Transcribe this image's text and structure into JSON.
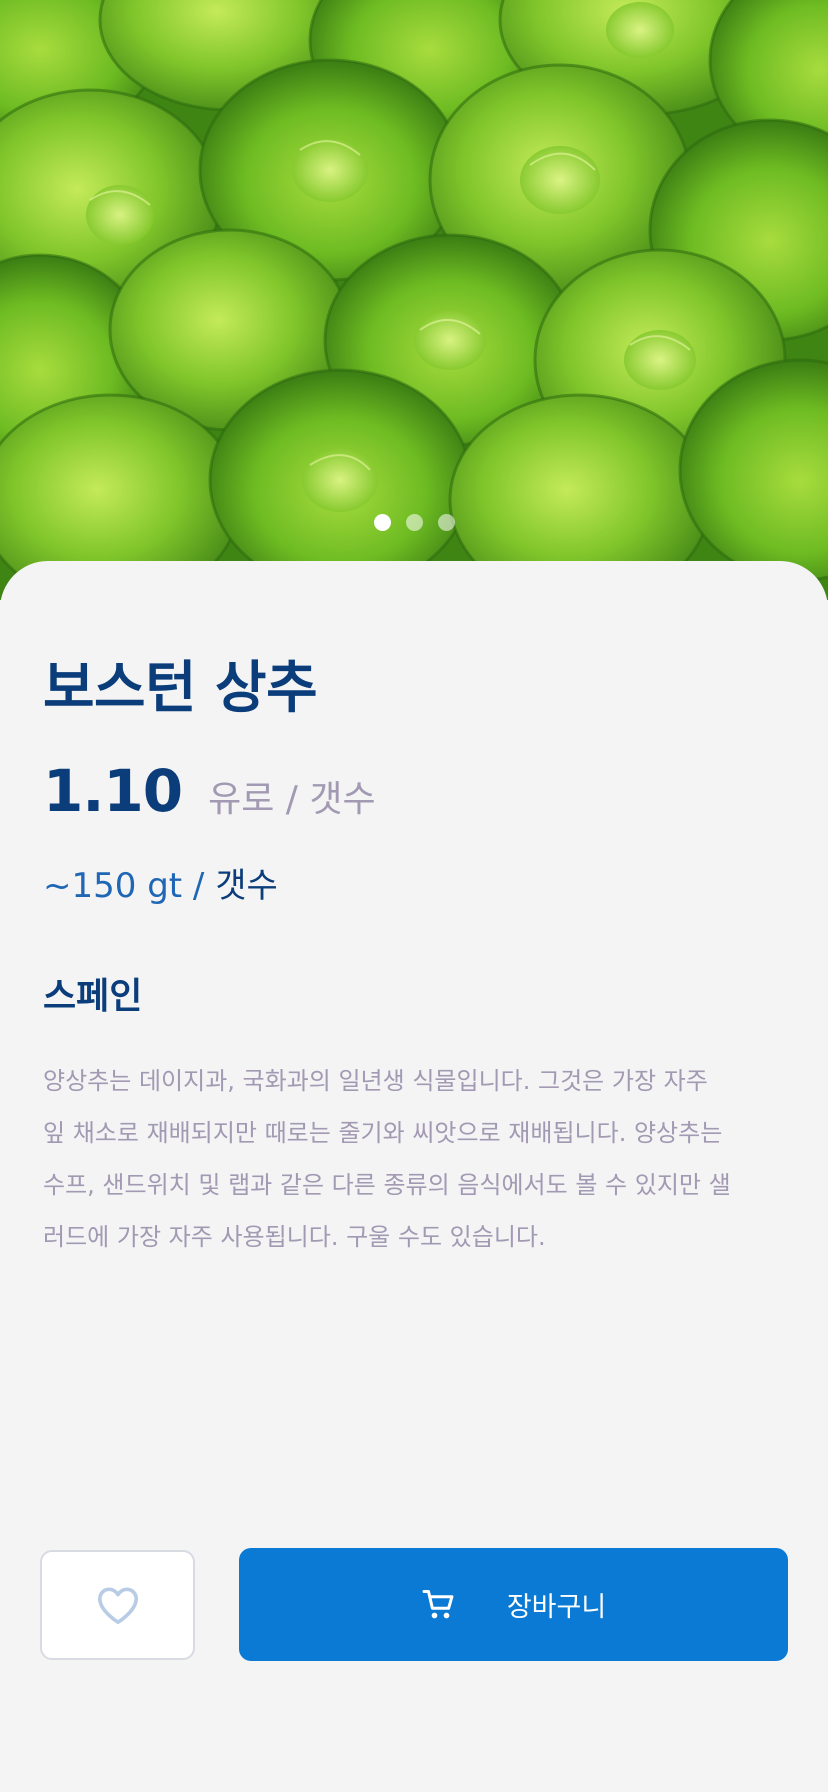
{
  "product": {
    "title": "보스턴 상추",
    "price": "1.10",
    "price_unit": "유로 / 갯수",
    "weight": "~150 gt /",
    "weight_per": "갯수",
    "origin": "스페인",
    "description": "양상추는 데이지과, 국화과의 일년생 식물입니다. 그것은 가장 자주 잎 채소로 재배되지만 때로는 줄기와 씨앗으로 재배됩니다. 양상추는 수프, 샌드위치 및 랩과 같은 다른 종류의 음식에서도 볼 수 있지만 샐러드에 가장 자주 사용됩니다. 구울 수도 있습니다."
  },
  "gallery": {
    "slide_count": 3,
    "active_index": 0,
    "image_icon": "lettuce-photo"
  },
  "actions": {
    "favorite_icon": "heart-outline-icon",
    "cart_icon": "cart-icon",
    "cart_label": "장바구니"
  },
  "colors": {
    "primary_dark": "#0a3d7a",
    "primary": "#0a7ad5",
    "muted": "#a299b2",
    "background": "#f4f4f5"
  }
}
